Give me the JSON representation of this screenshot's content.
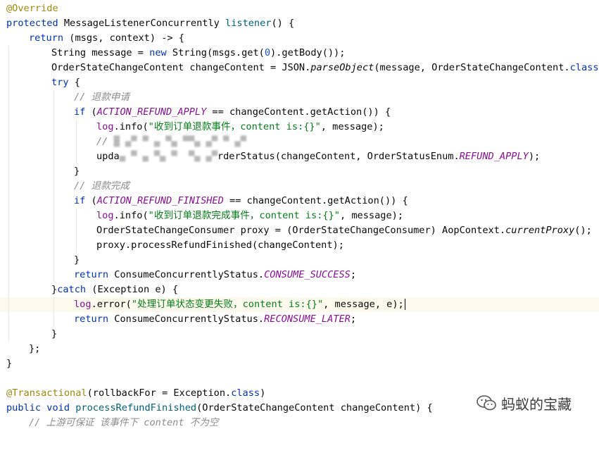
{
  "code": {
    "l01": {
      "t1": "@Override"
    },
    "l02": {
      "t1": "protected",
      "t2": " MessageListenerConcurrently ",
      "t3": "listener",
      "t4": "() {"
    },
    "l03": {
      "t1": "return",
      "t2": " (msgs, context) -> {"
    },
    "l04": {
      "t1": "String message = ",
      "t2": "new",
      "t3": " String(msgs.get(",
      "t4": "0",
      "t5": ").getBody());"
    },
    "l05": {
      "t1": "OrderStateChangeContent changeContent = JSON.",
      "t2": "parseObject",
      "t3": "(message, OrderStateChangeContent.",
      "t4": "class",
      "t5": ");"
    },
    "l06": {
      "t1": "try",
      "t2": " {"
    },
    "l07": {
      "t1": "// 退款申请"
    },
    "l08": {
      "t1": "if",
      "t2": " (",
      "t3": "ACTION_REFUND_APPLY",
      "t4": " == changeContent.getAction()) {"
    },
    "l09": {
      "t1": "log",
      "t2": ".info(",
      "t3": "\"收到订单退款事件，content is:{}\"",
      "t4": ", message);"
    },
    "l10": {
      "t1": "// "
    },
    "l11": {
      "t1": "upda",
      "t2": "rderStatus(changeContent, OrderStatusEnum.",
      "t3": "REFUND_APPLY",
      "t4": ");"
    },
    "l12": {
      "t1": "}"
    },
    "l13": {
      "t1": "// 退款完成"
    },
    "l14": {
      "t1": "if",
      "t2": " (",
      "t3": "ACTION_REFUND_FINISHED",
      "t4": " == changeContent.getAction()) {"
    },
    "l15": {
      "t1": "log",
      "t2": ".info(",
      "t3": "\"收到订单退款完成事件，content is:{}\"",
      "t4": ", message);"
    },
    "l16": {
      "t1": "OrderStateChangeConsumer proxy = (OrderStateChangeConsumer) AopContext.",
      "t2": "currentProxy",
      "t3": "();"
    },
    "l17": {
      "t1": "proxy.processRefundFinished(changeContent);"
    },
    "l18": {
      "t1": "}"
    },
    "l19": {
      "t1": "return",
      "t2": " ConsumeConcurrentlyStatus.",
      "t3": "CONSUME_SUCCESS",
      "t4": ";"
    },
    "l20": {
      "t1": "}",
      "t2": "catch",
      "t3": " (Exception e) {"
    },
    "l21": {
      "t1": "log",
      "t2": ".error(",
      "t3": "\"处理订单状态变更失败，content is:{}\"",
      "t4": ", message, e);"
    },
    "l22": {
      "t1": "return",
      "t2": " ConsumeConcurrentlyStatus.",
      "t3": "RECONSUME_LATER",
      "t4": ";"
    },
    "l23": {
      "t1": "}"
    },
    "l24": {
      "t1": "};"
    },
    "l25": {
      "t1": "}"
    },
    "l27": {
      "t1": "@Transactional",
      "t2": "(rollbackFor = Exception.",
      "t3": "class",
      "t4": ")"
    },
    "l28": {
      "t1": "public",
      "t2": " ",
      "t3": "void",
      "t4": " ",
      "t5": "processRefundFinished",
      "t6": "(OrderStateChangeContent changeContent) {"
    },
    "l29": {
      "t1": "// 上游可保证 该事件下 content 不为空"
    }
  },
  "watermark": {
    "label": "蚂蚁的宝藏",
    "icon": "wechat-icon"
  },
  "colors": {
    "keyword": "#0033b3",
    "annotation": "#9e880d",
    "field": "#871094",
    "string": "#067d17",
    "number": "#1750eb",
    "method": "#00627a",
    "comment": "#8c8c8c",
    "current_line": "#fcfaed"
  }
}
